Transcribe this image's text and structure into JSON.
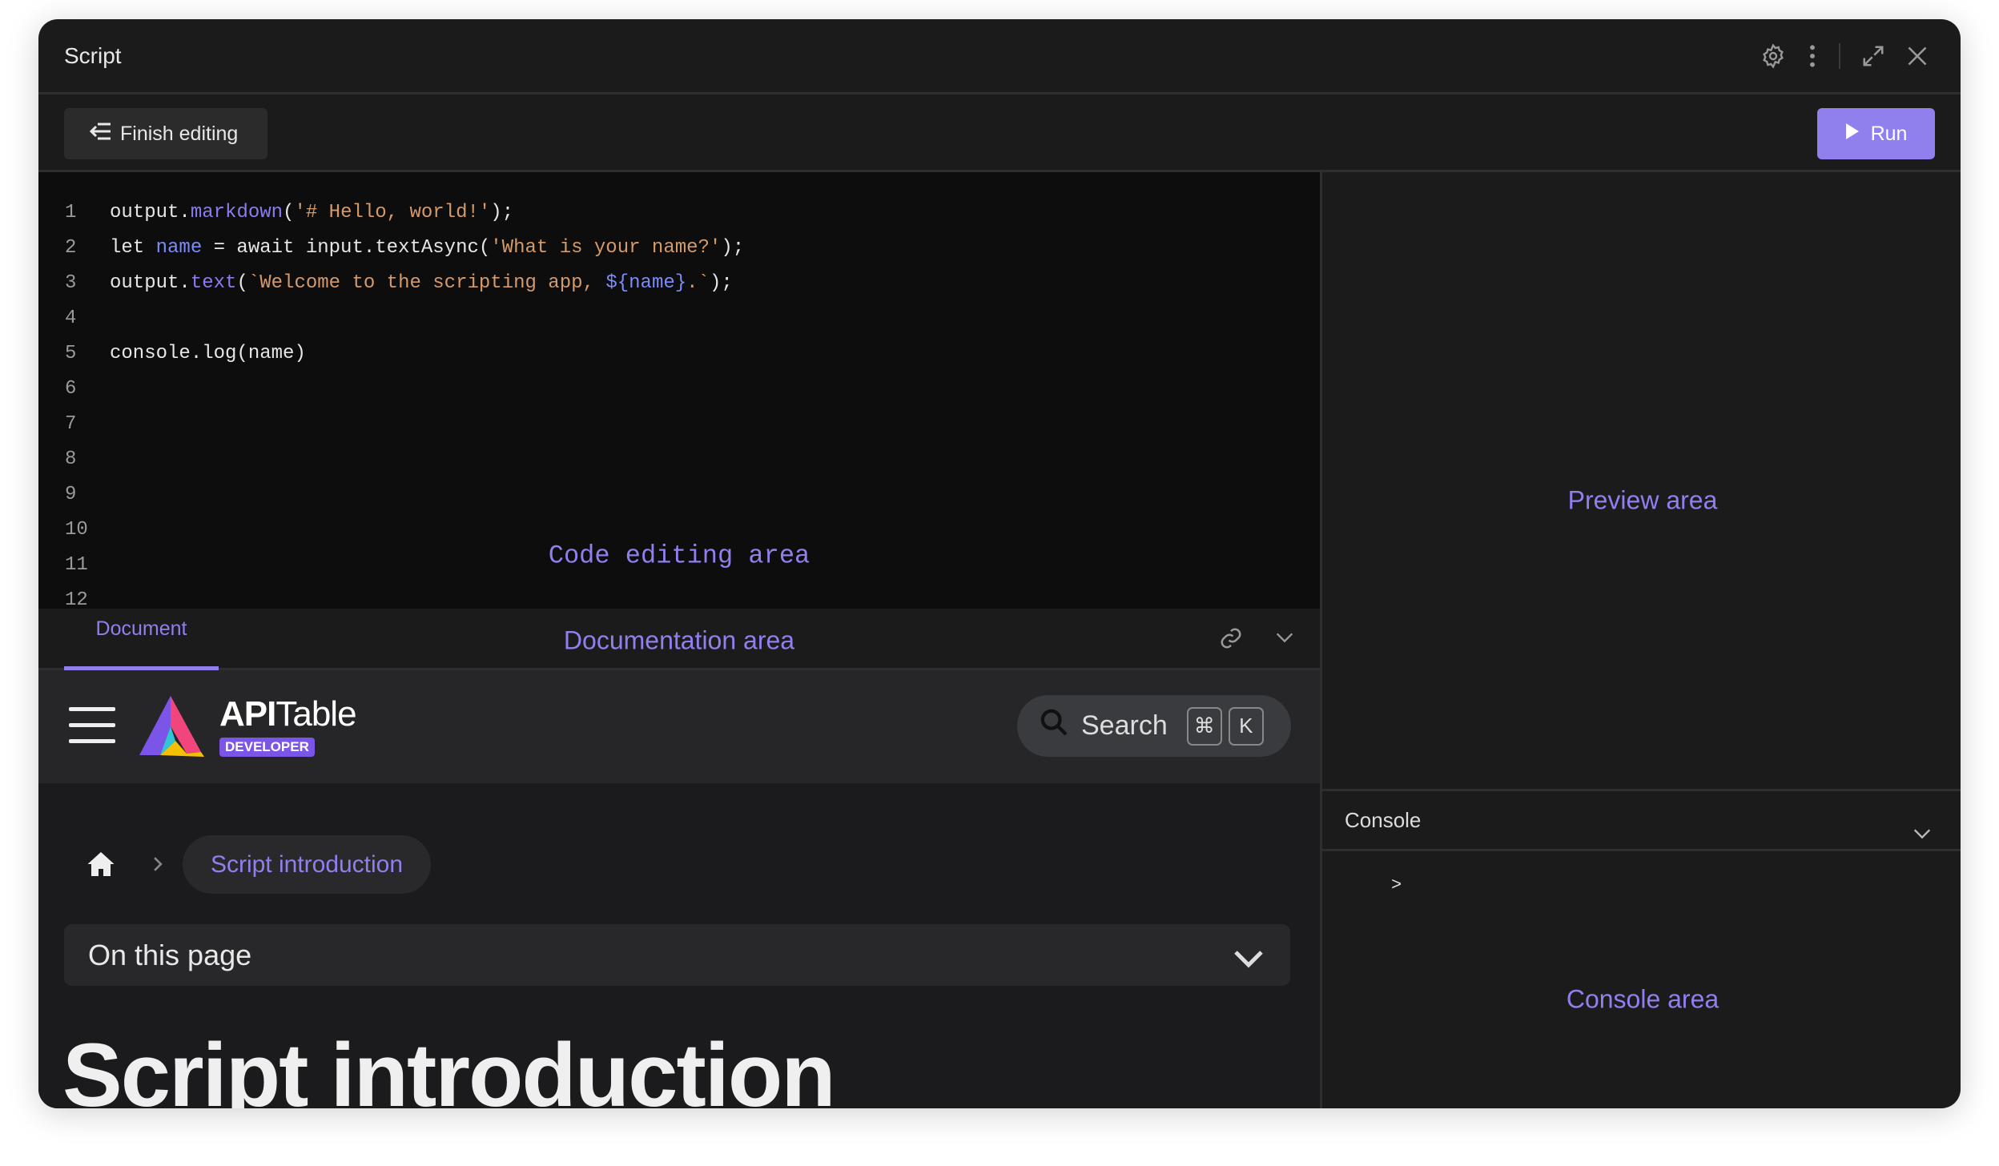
{
  "window": {
    "title": "Script"
  },
  "toolbar": {
    "finish_label": "Finish editing",
    "run_label": "Run"
  },
  "colors": {
    "accent": "#8f80ee",
    "window_bg": "#1b1b1b",
    "code_bg": "#0d0d0d",
    "string": "#d49a6a"
  },
  "editor": {
    "line_numbers": [
      "1",
      "2",
      "3",
      "4",
      "5",
      "6",
      "7",
      "8",
      "9",
      "10",
      "11",
      "12"
    ],
    "lines": [
      [
        {
          "t": "output."
        },
        {
          "t": "markdown",
          "c": "fn"
        },
        {
          "t": "("
        },
        {
          "t": "'# Hello, world!'",
          "c": "str"
        },
        {
          "t": ");"
        }
      ],
      [
        {
          "t": "let "
        },
        {
          "t": "name",
          "c": "var"
        },
        {
          "t": " = await input.textAsync("
        },
        {
          "t": "'What is your name?'",
          "c": "str"
        },
        {
          "t": ");"
        }
      ],
      [
        {
          "t": "output."
        },
        {
          "t": "text",
          "c": "fn"
        },
        {
          "t": "("
        },
        {
          "t": "`Welcome to the scripting app, ",
          "c": "str"
        },
        {
          "t": "${name}",
          "c": "var"
        },
        {
          "t": ".`",
          "c": "str"
        },
        {
          "t": ");"
        }
      ],
      [],
      [
        {
          "t": "console.log(name)"
        }
      ],
      [],
      [],
      [],
      [],
      [],
      [],
      []
    ],
    "area_label": "Code editing area"
  },
  "docs": {
    "tab_label": "Document",
    "area_label": "Documentation area",
    "brand_bold": "API",
    "brand_rest": "Table",
    "brand_badge": "DEVELOPER",
    "search_label": "Search",
    "kbd_cmd": "⌘",
    "kbd_k": "K",
    "breadcrumb_current": "Script introduction",
    "on_this_page": "On this page",
    "heading": "Script introduction"
  },
  "preview": {
    "area_label": "Preview area"
  },
  "console": {
    "title": "Console",
    "prompt": ">",
    "area_label": "Console area"
  }
}
